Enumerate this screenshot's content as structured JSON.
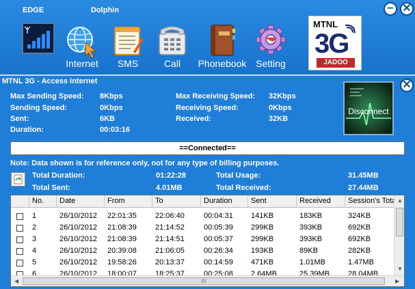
{
  "header": {
    "network_type": "EDGE",
    "operator": "Dolphin",
    "minimize_symbol": "−",
    "close_symbol": "✕"
  },
  "toolbar": {
    "items": [
      {
        "label": "Internet",
        "icon": "globe-cursor-icon"
      },
      {
        "label": "SMS",
        "icon": "notepad-icon"
      },
      {
        "label": "Call",
        "icon": "telephone-icon"
      },
      {
        "label": "Phonebook",
        "icon": "book-icon"
      },
      {
        "label": "Setting",
        "icon": "gear-icon"
      }
    ],
    "signal_icon": "signal-strength-icon"
  },
  "logo": {
    "line1": "MTNL",
    "line2": "3G",
    "line3": "JADOO"
  },
  "panel": {
    "title": "MTNL 3G - Access Internet",
    "close_symbol": "✕",
    "stats_left": [
      {
        "label": "Max Sending Speed:",
        "value": "8Kbps"
      },
      {
        "label": "Sending Speed:",
        "value": "0Kbps"
      },
      {
        "label": "Sent:",
        "value": "6KB"
      },
      {
        "label": "Duration:",
        "value": "00:03:16"
      }
    ],
    "stats_right": [
      {
        "label": "Max Receiving Speed:",
        "value": "32Kbps"
      },
      {
        "label": "Receiving Speed:",
        "value": "0Kbps"
      },
      {
        "label": "Received:",
        "value": "32KB"
      }
    ],
    "disconnect_label": "Disconnect",
    "status": "==Connected==",
    "note": "Note: Data shown is for reference only, not for any type of billing purposes.",
    "totals": {
      "total_duration_label": "Total Duration:",
      "total_duration": "01:22:28",
      "total_sent_label": "Total Sent:",
      "total_sent": "4.01MB",
      "total_usage_label": "Total Usage:",
      "total_usage": "31.45MB",
      "total_received_label": "Total Received:",
      "total_received": "27.44MB"
    }
  },
  "table": {
    "columns": [
      "No.",
      "Date",
      "From",
      "To",
      "Duration",
      "Sent",
      "Received",
      "Session's Total"
    ],
    "rows": [
      [
        "1",
        "26/10/2012",
        "22:01:35",
        "22:06:40",
        "00:04:31",
        "141KB",
        "183KB",
        "324KB"
      ],
      [
        "2",
        "26/10/2012",
        "21:08:39",
        "21:14:52",
        "00:05:39",
        "299KB",
        "393KB",
        "692KB"
      ],
      [
        "3",
        "26/10/2012",
        "21:08:39",
        "21:14:51",
        "00:05:37",
        "299KB",
        "393KB",
        "692KB"
      ],
      [
        "4",
        "26/10/2012",
        "20:39:08",
        "21:06:05",
        "00:26:34",
        "193KB",
        "89KB",
        "282KB"
      ],
      [
        "5",
        "26/10/2012",
        "19:58:26",
        "20:13:37",
        "00:14:59",
        "471KB",
        "1.01MB",
        "1.47MB"
      ],
      [
        "6",
        "26/10/2012",
        "18:00:07",
        "18:25:37",
        "00:25:08",
        "2.64MB",
        "25.39MB",
        "28.04MB"
      ]
    ],
    "scroll_grip": "III"
  },
  "colors": {
    "background": "#1e7ed8",
    "status_bar": "#ffffff",
    "logo_red": "#c3262c",
    "logo_navy": "#1c2a6e"
  }
}
